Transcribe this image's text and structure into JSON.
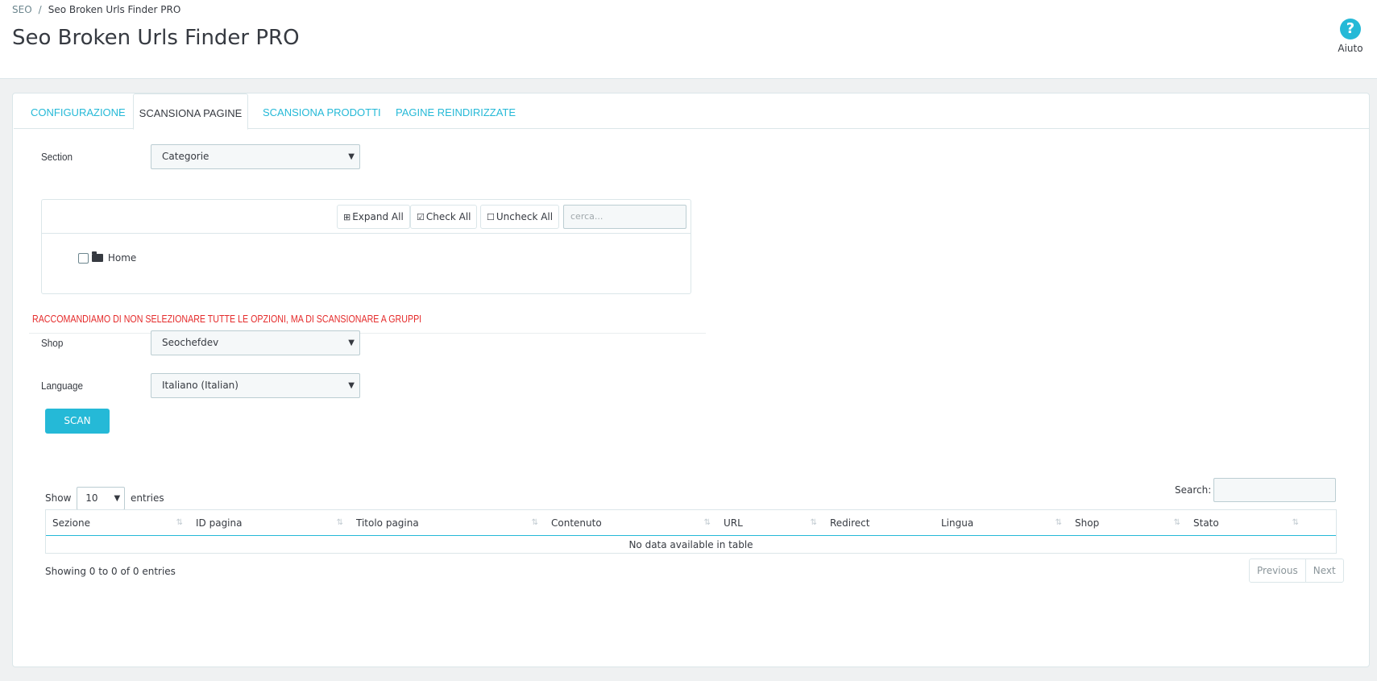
{
  "breadcrumb": {
    "parent": "SEO",
    "separator": "/",
    "current": "Seo Broken Urls Finder PRO"
  },
  "page_title": "Seo Broken Urls Finder PRO",
  "help": {
    "icon": "question-circle-icon",
    "label": "Aiuto"
  },
  "tabs": [
    {
      "label": "CONFIGURAZIONE",
      "active": false
    },
    {
      "label": "SCANSIONA PAGINE",
      "active": true
    },
    {
      "label": "SCANSIONA PRODOTTI",
      "active": false
    },
    {
      "label": "PAGINE REINDIRIZZATE",
      "active": false
    }
  ],
  "form": {
    "section": {
      "label": "Section",
      "value": "Categorie"
    },
    "shop": {
      "label": "Shop",
      "value": "Seochefdev"
    },
    "language": {
      "label": "Language",
      "value": "Italiano (Italian)"
    }
  },
  "tree": {
    "expand_all": "Expand All",
    "check_all": "Check All",
    "uncheck_all": "Uncheck All",
    "search_placeholder": "cerca...",
    "items": [
      {
        "label": "Home",
        "checked": false
      }
    ]
  },
  "warning": "RACCOMANDIAMO DI NON SELEZIONARE TUTTE LE OPZIONI, MA DI SCANSIONARE A GRUPPI",
  "scan_button": "SCAN",
  "datatable": {
    "show_label": "Show",
    "length_value": "10",
    "entries_label": "entries",
    "search_label": "Search:",
    "columns": [
      "Sezione",
      "ID pagina",
      "Titolo pagina",
      "Contenuto",
      "URL",
      "Redirect",
      "Lingua",
      "Shop",
      "Stato"
    ],
    "empty_message": "No data available in table",
    "info": "Showing 0 to 0 of 0 entries",
    "previous": "Previous",
    "next": "Next"
  },
  "colors": {
    "accent": "#25b9d7",
    "warning": "#e52b2b",
    "text": "#363a41"
  }
}
